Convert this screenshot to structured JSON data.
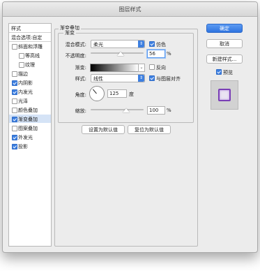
{
  "window": {
    "title": "图层样式"
  },
  "sidebar": {
    "header": "样式",
    "blend_options": "混合选项:自定",
    "items": [
      {
        "label": "斜面和浮雕",
        "checked": false,
        "selected": false
      },
      {
        "label": "等高线",
        "checked": false,
        "selected": false
      },
      {
        "label": "纹理",
        "checked": false,
        "selected": false
      },
      {
        "label": "描边",
        "checked": false,
        "selected": false
      },
      {
        "label": "内阴影",
        "checked": true,
        "selected": false
      },
      {
        "label": "内发光",
        "checked": true,
        "selected": false
      },
      {
        "label": "光泽",
        "checked": false,
        "selected": false
      },
      {
        "label": "颜色叠加",
        "checked": false,
        "selected": false
      },
      {
        "label": "渐变叠加",
        "checked": true,
        "selected": true
      },
      {
        "label": "图案叠加",
        "checked": false,
        "selected": false
      },
      {
        "label": "外发光",
        "checked": true,
        "selected": false
      },
      {
        "label": "投影",
        "checked": true,
        "selected": false
      }
    ]
  },
  "panel": {
    "section_title": "渐变叠加",
    "subsection_title": "渐变",
    "blend_mode_label": "混合模式:",
    "blend_mode_value": "柔光",
    "dither_label": "仿色",
    "dither_checked": true,
    "opacity_label": "不透明度:",
    "opacity_value": "56",
    "opacity_unit": "%",
    "opacity_fraction": 0.56,
    "gradient_label": "渐变:",
    "reverse_label": "反向",
    "reverse_checked": false,
    "style_label": "样式:",
    "style_value": "线性",
    "align_label": "与图层对齐",
    "align_checked": true,
    "angle_label": "角度:",
    "angle_value": "125",
    "angle_unit": "度",
    "scale_label": "缩放:",
    "scale_value": "100",
    "scale_unit": "%",
    "scale_fraction": 0.67,
    "set_default_label": "设置为默认值",
    "reset_default_label": "复位为默认值"
  },
  "actions": {
    "ok_label": "确定",
    "cancel_label": "取消",
    "new_style_label": "新建样式...",
    "preview_label": "预览",
    "preview_checked": true
  },
  "colors": {
    "accent": "#3d7fe0",
    "selected_row": "#d5e3f6",
    "preview_border": "#7a3fb6"
  }
}
